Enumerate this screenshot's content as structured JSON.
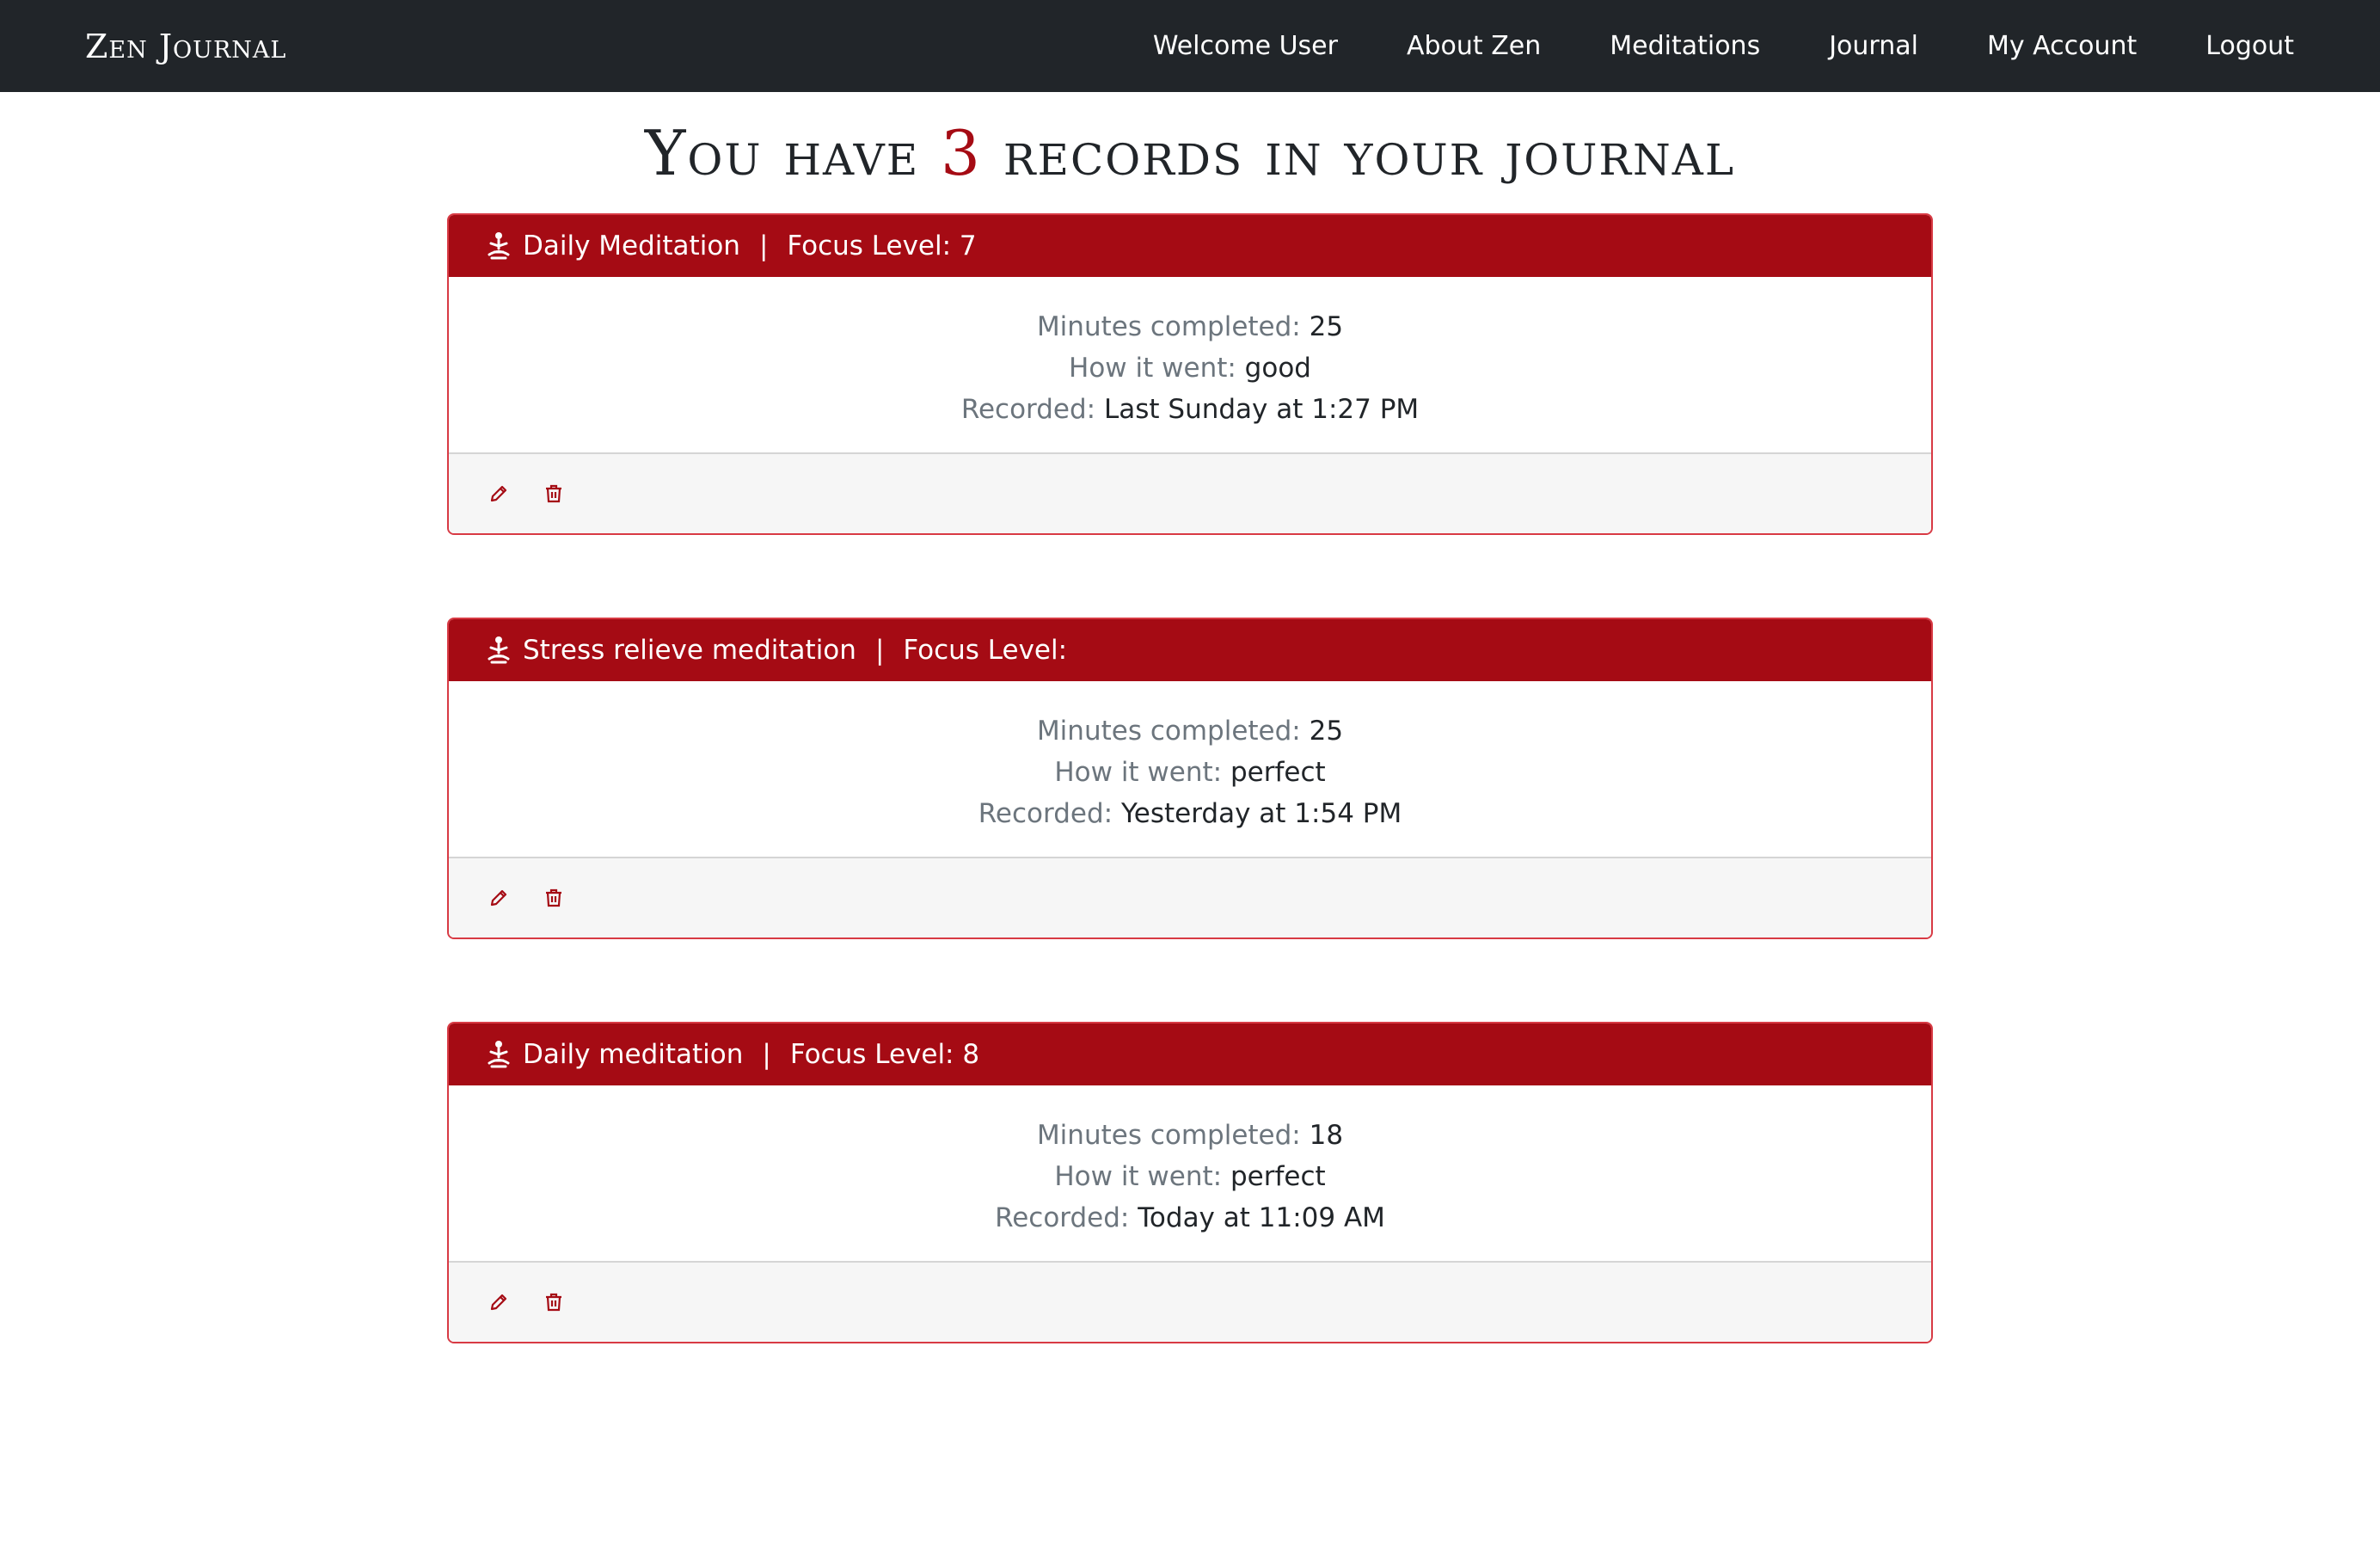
{
  "nav": {
    "brand": "Zen Journal",
    "links": [
      "Welcome User",
      "About Zen",
      "Meditations",
      "Journal",
      "My Account",
      "Logout"
    ]
  },
  "title": {
    "prefix": "You have",
    "count": "3",
    "suffix": "records in your journal"
  },
  "labels": {
    "focus": "Focus Level:",
    "separator": "|",
    "minutes": "Minutes completed:",
    "how": "How it went:",
    "recorded": "Recorded:"
  },
  "records": [
    {
      "name": "Daily Meditation",
      "focus": "7",
      "minutes": "25",
      "how": "good",
      "recorded": "Last Sunday at 1:27 PM"
    },
    {
      "name": "Stress relieve meditation",
      "focus": "",
      "minutes": "25",
      "how": "perfect",
      "recorded": "Yesterday at 1:54 PM"
    },
    {
      "name": "Daily meditation",
      "focus": "8",
      "minutes": "18",
      "how": "perfect",
      "recorded": "Today at 11:09 AM"
    }
  ],
  "icons": {
    "header": "meditate-icon",
    "edit": "pencil-icon",
    "delete": "trash-icon"
  },
  "colors": {
    "accent": "#a50b14",
    "navbar": "#212529",
    "border": "#d83a44"
  }
}
